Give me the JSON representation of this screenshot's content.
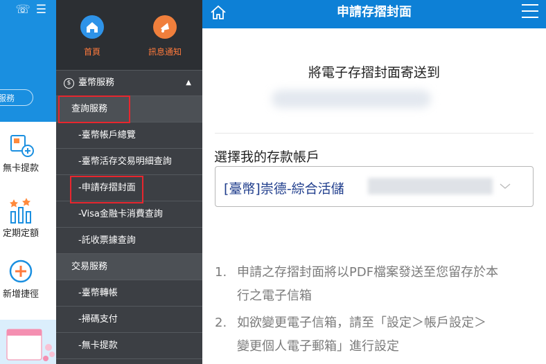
{
  "background_app": {
    "search_text": "服務",
    "tiles": [
      {
        "label": "無卡提款",
        "icon": "card-withdraw-icon"
      },
      {
        "label": "定期定額",
        "icon": "stars-bars-icon"
      },
      {
        "label": "新增捷徑",
        "icon": "add-circle-icon"
      }
    ]
  },
  "menu": {
    "tabs": [
      {
        "label": "首頁",
        "icon": "home-icon",
        "color": "#2e93e8"
      },
      {
        "label": "訊息通知",
        "icon": "megaphone-icon",
        "color": "#f07f3c"
      }
    ],
    "section_title": "臺幣服務",
    "items": [
      {
        "label": "查詢服務",
        "type": "section"
      },
      {
        "label": "-臺幣帳戶總覽",
        "type": "item"
      },
      {
        "label": "-臺幣活存交易明細查詢",
        "type": "item"
      },
      {
        "label": "-申請存摺封面",
        "type": "item"
      },
      {
        "label": "-Visa金融卡消費查詢",
        "type": "item"
      },
      {
        "label": "-託收票據查詢",
        "type": "item"
      },
      {
        "label": "交易服務",
        "type": "section"
      },
      {
        "label": "-臺幣轉帳",
        "type": "item"
      },
      {
        "label": "-掃碼支付",
        "type": "item"
      },
      {
        "label": "-無卡提款",
        "type": "item"
      }
    ]
  },
  "panel": {
    "title": "申請存摺封面",
    "send_to": "將電子存摺封面寄送到",
    "account_label": "選擇我的存款帳戶",
    "account_value": "[臺幣]崇德-綜合活儲",
    "notes": [
      {
        "num": "1.",
        "line1": "申請之存摺封面將以PDF檔案發送至您留存於本",
        "line2": "行之電子信箱"
      },
      {
        "num": "2.",
        "line1": "如欲變更電子信箱，請至「設定＞帳戶設定＞",
        "line2": "變更個人電子郵箱」進行設定"
      }
    ]
  },
  "colors": {
    "header_blue": "#0d80d6",
    "menu_bg": "#3c3f44",
    "highlight_red": "#e8262e",
    "accent_orange": "#ff7a3c"
  }
}
